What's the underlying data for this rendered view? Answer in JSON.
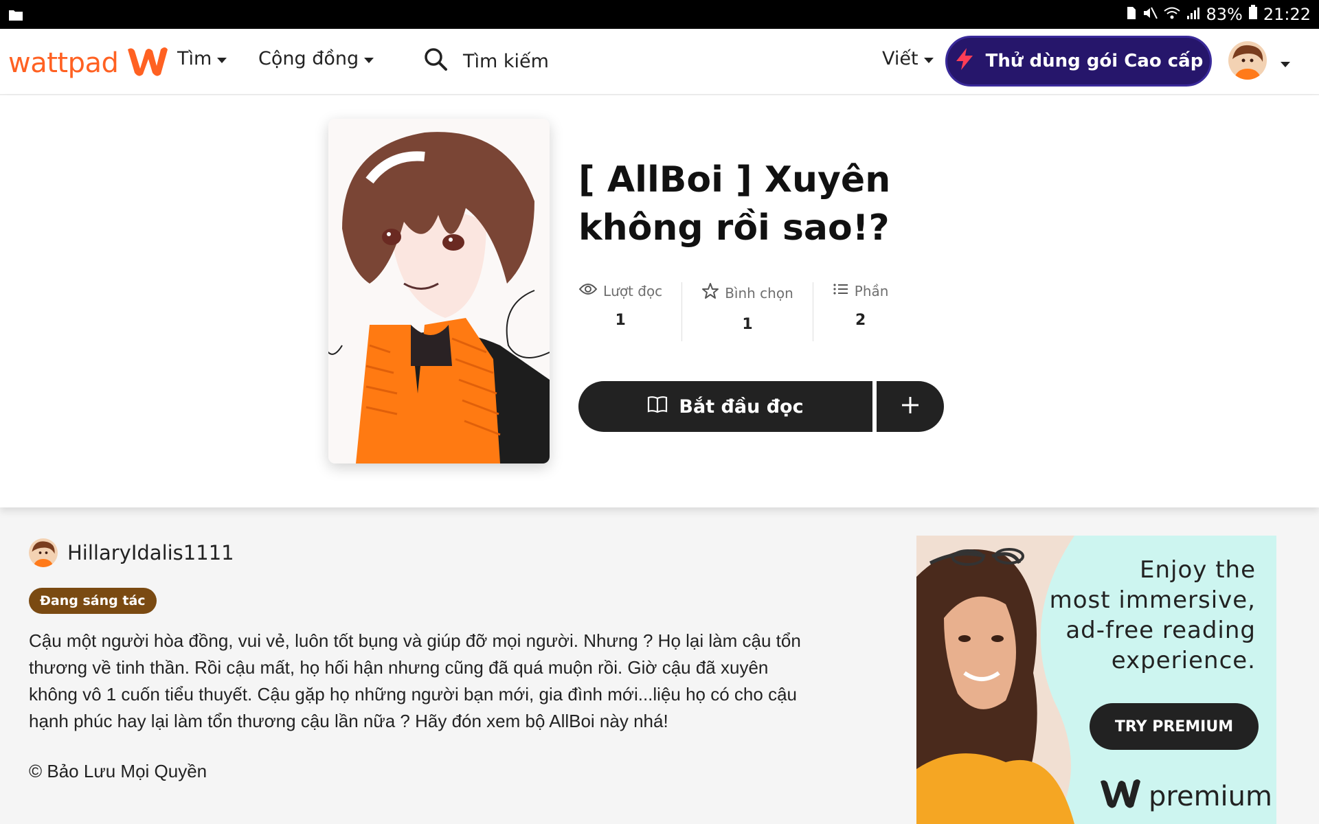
{
  "status_bar": {
    "battery": "83%",
    "time": "21:22"
  },
  "nav": {
    "logo_text": "wattpad",
    "discover": "Tìm",
    "community": "Cộng đồng",
    "search_label": "Tìm kiếm",
    "write": "Viết",
    "premium_cta": "Thử dùng gói Cao cấp"
  },
  "story": {
    "title": "[ AllBoi ] Xuyên không rồi sao!?",
    "stats": [
      {
        "label": "Lượt đọc",
        "value": "1"
      },
      {
        "label": "Bình chọn",
        "value": "1"
      },
      {
        "label": "Phần",
        "value": "2"
      }
    ],
    "start_reading": "Bắt đầu đọc"
  },
  "details": {
    "author": "HillaryIdalis1111",
    "status_badge": "Đang sáng tác",
    "description": "Cậu một người hòa đồng, vui vẻ, luôn tốt bụng và giúp đỡ mọi người. Nhưng ? Họ lại làm cậu tổn thương về tinh thần. Rồi cậu mất, họ hối hận nhưng cũng đã quá muộn rồi. Giờ cậu đã xuyên không vô 1 cuốn tiểu thuyết. Cậu gặp họ những người bạn mới, gia đình mới...liệu họ có cho cậu hạnh phúc hay lại làm tổn thương cậu lần nữa ? Hãy đón xem bộ AllBoi này nhá!",
    "copyright": "© Bảo Lưu Mọi Quyền"
  },
  "ad": {
    "line1": "Enjoy the",
    "line2": "most immersive,",
    "line3": "ad-free reading",
    "line4": "experience.",
    "button": "TRY PREMIUM",
    "brand": "premium"
  },
  "colors": {
    "brand_orange": "#ff6122",
    "premium_purple": "#26166b",
    "badge_brown": "#7a4a12",
    "ad_bg": "#cdf5f0"
  }
}
